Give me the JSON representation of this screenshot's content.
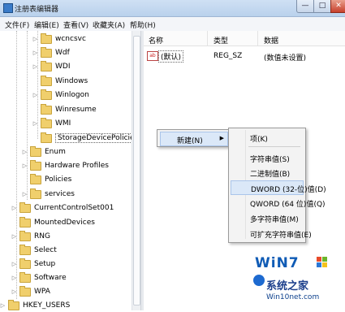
{
  "window": {
    "title": "注册表编辑器",
    "min": "—",
    "max": "□",
    "close": "✕"
  },
  "menu": [
    "文件(F)",
    "编辑(E)",
    "查看(V)",
    "收藏夹(A)",
    "帮助(H)"
  ],
  "tree": {
    "items": [
      {
        "label": "wcncsvc",
        "expand": "▷"
      },
      {
        "label": "Wdf",
        "expand": "▷"
      },
      {
        "label": "WDI",
        "expand": "▷"
      },
      {
        "label": "Windows",
        "expand": ""
      },
      {
        "label": "Winlogon",
        "expand": "▷"
      },
      {
        "label": "Winresume",
        "expand": ""
      },
      {
        "label": "WMI",
        "expand": "▷"
      },
      {
        "label": "StorageDevicePolicies",
        "expand": ""
      },
      {
        "label": "Enum",
        "expand": "▷"
      },
      {
        "label": "Hardware Profiles",
        "expand": "▷"
      },
      {
        "label": "Policies",
        "expand": ""
      },
      {
        "label": "services",
        "expand": "▷"
      },
      {
        "label": "CurrentControlSet001",
        "expand": "▷"
      },
      {
        "label": "MountedDevices",
        "expand": ""
      },
      {
        "label": "RNG",
        "expand": "▷"
      },
      {
        "label": "Select",
        "expand": ""
      },
      {
        "label": "Setup",
        "expand": "▷"
      },
      {
        "label": "Software",
        "expand": "▷"
      },
      {
        "label": "WPA",
        "expand": "▷"
      },
      {
        "label": "HKEY_USERS",
        "expand": "▷"
      }
    ]
  },
  "list": {
    "columns": [
      "名称",
      "类型",
      "数据"
    ],
    "rows": [
      {
        "icon": "ab",
        "name": "(默认)",
        "type": "REG_SZ",
        "data": "(数值未设置)"
      }
    ]
  },
  "context_menu": {
    "new_label": "新建(N)",
    "submenu_arrow": "▶",
    "items": [
      "项(K)",
      "字符串值(S)",
      "二进制值(B)",
      "DWORD (32-位)值(D)",
      "QWORD (64 位)值(Q)",
      "多字符串值(M)",
      "可扩充字符串值(E)"
    ],
    "highlighted": "DWORD (32-位)值(D)"
  },
  "watermark": {
    "logo": "WiN7",
    "name": "系统之家",
    "url": "Win10net.com"
  },
  "colors": {
    "highlight": "#dbe8f8",
    "folder": "#f0cf6c",
    "brand_blue": "#0f5bb5"
  }
}
